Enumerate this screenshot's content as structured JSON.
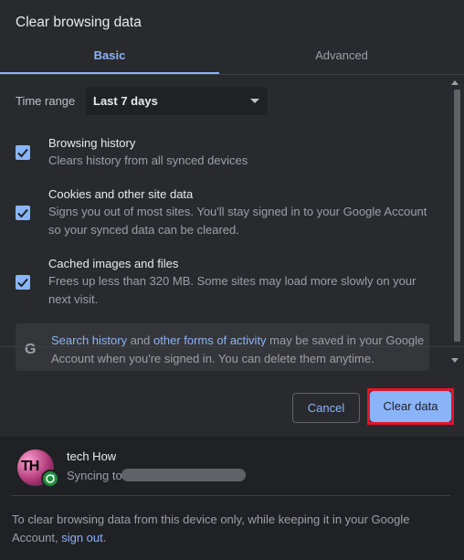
{
  "dialog": {
    "title": "Clear browsing data"
  },
  "tabs": [
    {
      "label": "Basic",
      "selected": true
    },
    {
      "label": "Advanced",
      "selected": false
    }
  ],
  "time_range": {
    "label": "Time range",
    "value": "Last 7 days"
  },
  "options": [
    {
      "title": "Browsing history",
      "description": "Clears history from all synced devices",
      "checked": true
    },
    {
      "title": "Cookies and other site data",
      "description": "Signs you out of most sites. You'll stay signed in to your Google Account so your synced data can be cleared.",
      "checked": true
    },
    {
      "title": "Cached images and files",
      "description": "Frees up less than 320 MB. Some sites may load more slowly on your next visit.",
      "checked": true
    }
  ],
  "notice": {
    "icon": "google-g-icon",
    "link1": "Search history",
    "text1": " and ",
    "link2": "other forms of activity",
    "text2": " may be saved in your Google Account when you're signed in. You can delete them anytime."
  },
  "buttons": {
    "cancel": "Cancel",
    "clear": "Clear data"
  },
  "account": {
    "avatar_letters": "TH",
    "name": "tech How",
    "sync_label": "Syncing to"
  },
  "footer": {
    "text": "To clear browsing data from this device only, while keeping it in your Google Account, ",
    "link": "sign out",
    "text_end": "."
  },
  "colors": {
    "accent": "#8ab4f8",
    "background": "#292a2d",
    "highlight": "#e0152b"
  }
}
